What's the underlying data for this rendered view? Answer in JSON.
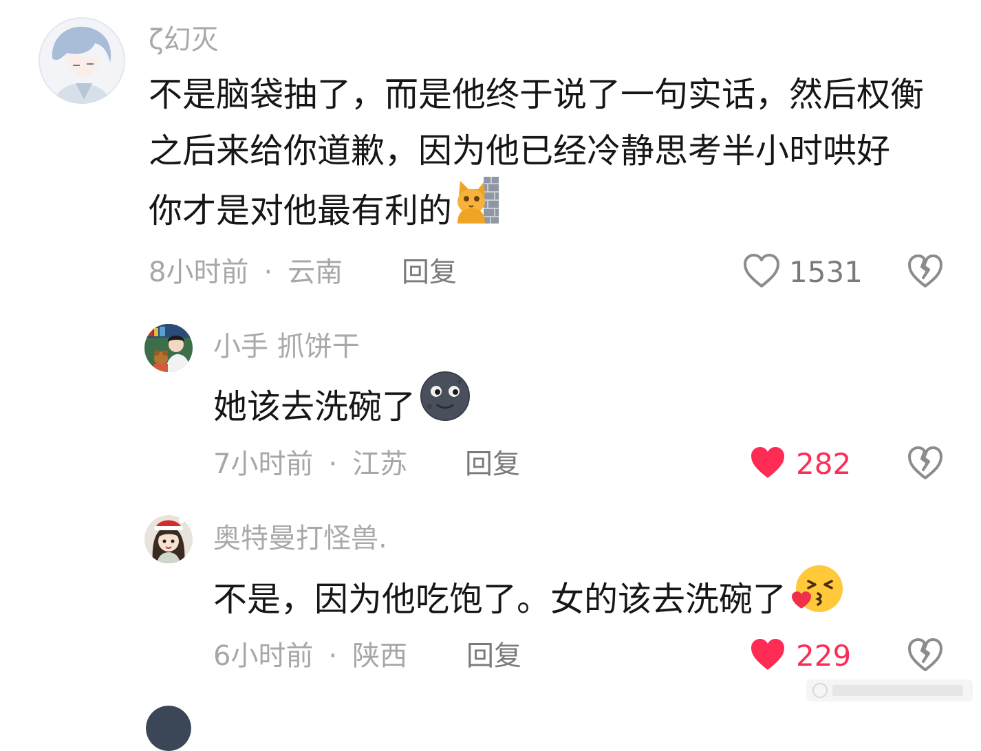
{
  "comments": [
    {
      "username": "ζ幻灭",
      "lines": [
        "不是脑袋抽了，而是他终于说了一句实话，然后权衡",
        "之后来给你道歉，因为他已经冷静思考半小时哄好",
        "你才是对他最有利的"
      ],
      "emoji": "cat-wall-emoji",
      "time": "8小时前",
      "location": "云南",
      "reply_label": "回复",
      "likes": "1531",
      "liked": false
    },
    {
      "username": "小手 抓饼干",
      "lines": [
        "她该去洗碗了"
      ],
      "emoji": "moon-face-emoji",
      "time": "7小时前",
      "location": "江苏",
      "reply_label": "回复",
      "likes": "282",
      "liked": true
    },
    {
      "username": "奥特曼打怪兽.",
      "lines": [
        "不是，因为他吃饱了。女的该去洗碗了"
      ],
      "emoji": "kissing-face-emoji",
      "time": "6小时前",
      "location": "陕西",
      "reply_label": "回复",
      "likes": "229",
      "liked": true
    }
  ],
  "separator": "·",
  "colors": {
    "liked": "#fe2c55",
    "meta": "#a7a7a7",
    "text": "#161616"
  },
  "icons": {
    "like": "heart-icon",
    "dislike": "broken-heart-icon"
  }
}
